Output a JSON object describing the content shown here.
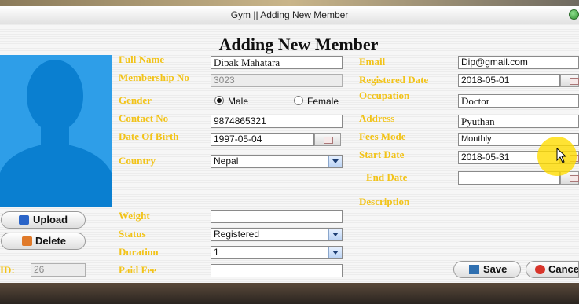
{
  "window": {
    "title": "Gym || Adding New Member"
  },
  "heading": "Adding New Member",
  "photo_buttons": {
    "upload": "Upload",
    "delete": "Delete"
  },
  "id_field": {
    "label": "ID:",
    "value": "26"
  },
  "labels": {
    "full_name": "Full Name",
    "membership_no": "Membership No",
    "gender": "Gender",
    "contact_no": "Contact No",
    "date_of_birth": "Date Of Birth",
    "country": "Country",
    "weight": "Weight",
    "status": "Status",
    "duration": "Duration",
    "paid_fee": "Paid Fee",
    "email": "Email",
    "registered_date": "Registered Date",
    "occupation": "Occupation",
    "address": "Address",
    "fees_mode": "Fees Mode",
    "start_date": "Start Date",
    "end_date": "End Date",
    "description": "Description"
  },
  "values": {
    "full_name": "Dipak Mahatara",
    "membership_no": "3023",
    "contact_no": "9874865321",
    "date_of_birth": "1997-05-04",
    "country": "Nepal",
    "weight": "",
    "status": "Registered",
    "duration": "1",
    "paid_fee": "",
    "email": "Dip@gmail.com",
    "registered_date": "2018-05-01",
    "occupation": "Doctor",
    "address": "Pyuthan",
    "fees_mode": "Monthly",
    "start_date": "2018-05-31",
    "end_date": ""
  },
  "gender": {
    "male": "Male",
    "female": "Female",
    "selected": "male"
  },
  "actions": {
    "save": "Save",
    "cancel": "Cancel"
  },
  "colors": {
    "label": "#f2c318",
    "photo_bg": "#2e9ee8"
  }
}
